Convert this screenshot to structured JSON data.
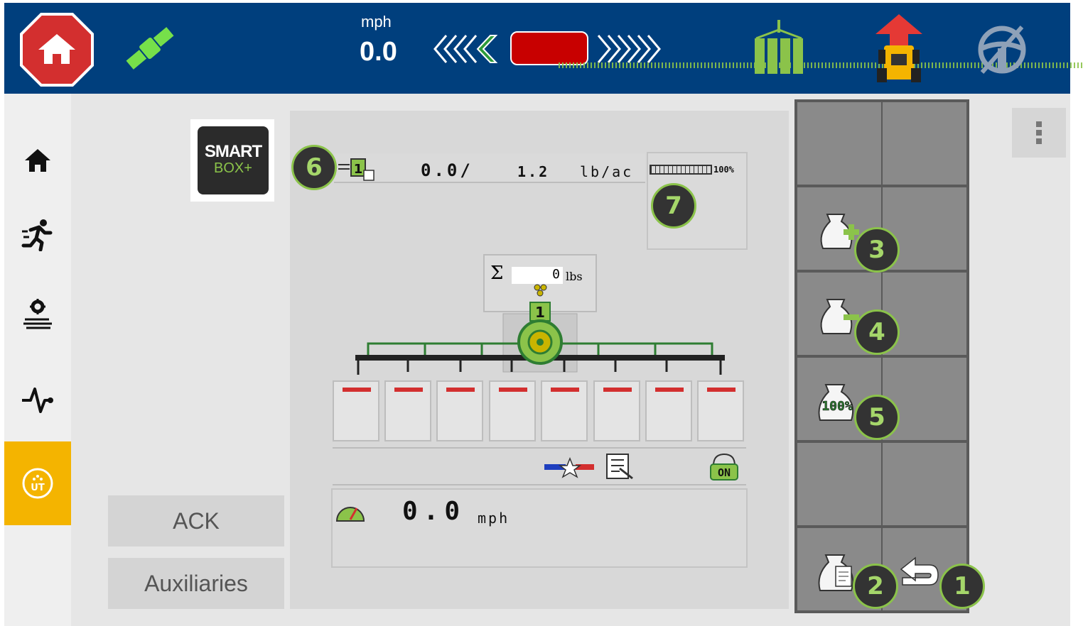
{
  "topbar": {
    "speed_unit": "mph",
    "speed_value": "0.0"
  },
  "logo": {
    "line1": "SMART",
    "line2": "BOX+"
  },
  "buttons": {
    "ack": "ACK",
    "auxiliaries": "Auxiliaries"
  },
  "rate": {
    "actual": "0.0/",
    "target": "1.2",
    "unit": "lb/ac"
  },
  "level": {
    "percent_label": "100%",
    "percent": 100
  },
  "hopper": {
    "sigma": "Σ",
    "value": "0",
    "unit": "lbs",
    "meter_number": "1",
    "product_number": "1"
  },
  "speed": {
    "value": "0.0",
    "unit": "mph"
  },
  "status": {
    "on_label": "ON"
  },
  "softkeys": {
    "level_100_label": "100%"
  },
  "callouts": [
    "1",
    "2",
    "3",
    "4",
    "5",
    "6",
    "7"
  ],
  "colors": {
    "topbar": "#003f7d",
    "accent_green": "#8bc34a",
    "active_nav": "#f4b400",
    "alarm_red": "#c80000"
  }
}
